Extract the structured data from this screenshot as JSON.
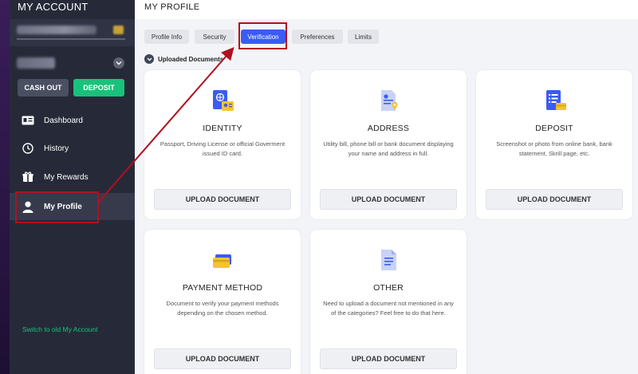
{
  "sidebar": {
    "title": "MY ACCOUNT",
    "cashout_label": "CASH OUT",
    "deposit_label": "DEPOSIT",
    "items": [
      {
        "label": "Dashboard",
        "icon": "dashboard-icon"
      },
      {
        "label": "History",
        "icon": "clock-icon"
      },
      {
        "label": "My Rewards",
        "icon": "gift-icon"
      },
      {
        "label": "My Profile",
        "icon": "user-icon"
      }
    ],
    "switch_link": "Switch to old My Account"
  },
  "header": {
    "title": "MY PROFILE"
  },
  "tabs": [
    {
      "label": "Profile Info"
    },
    {
      "label": "Security"
    },
    {
      "label": "Verification",
      "active": true
    },
    {
      "label": "Preferences"
    },
    {
      "label": "Limits"
    }
  ],
  "section": {
    "title": "Uploaded Documents"
  },
  "cards": [
    {
      "title": "IDENTITY",
      "description": "Passport, Driving License or official Goverment issued ID card.",
      "button": "UPLOAD DOCUMENT",
      "icon": "passport-icon"
    },
    {
      "title": "ADDRESS",
      "description": "Utility bill, phone bill or bank document displaying your name and address in full.",
      "button": "UPLOAD DOCUMENT",
      "icon": "address-document-icon"
    },
    {
      "title": "DEPOSIT",
      "description": "Screenshot or photo from online bank, bank statement, Skrill page, etc.",
      "button": "UPLOAD DOCUMENT",
      "icon": "deposit-document-icon"
    },
    {
      "title": "PAYMENT METHOD",
      "description": "Document to verify your payment methods depending on the chosen method.",
      "button": "UPLOAD DOCUMENT",
      "icon": "credit-card-icon"
    },
    {
      "title": "OTHER",
      "description": "Need to upload a document not mentioned in any of the categories? Feel free to do that here.",
      "button": "UPLOAD DOCUMENT",
      "icon": "document-icon"
    }
  ],
  "colors": {
    "sidebar_bg": "#262a38",
    "accent_blue": "#3b5bf5",
    "accent_green": "#18c27a",
    "annotation_red": "#b01020"
  }
}
